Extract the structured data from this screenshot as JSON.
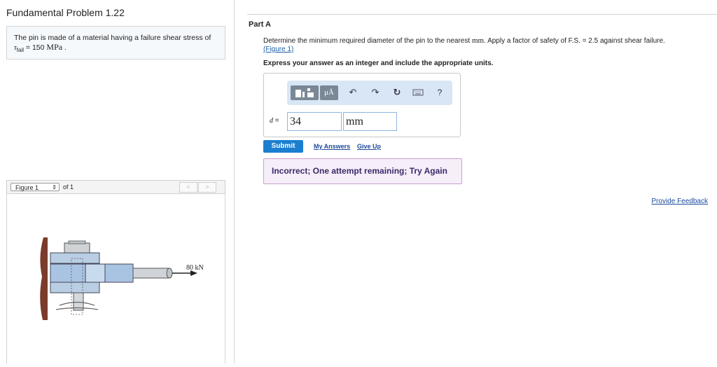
{
  "problem": {
    "title": "Fundamental Problem 1.22",
    "intro_text": "The pin is made of a material having a failure shear stress of",
    "tau_symbol": "τ",
    "tau_subscript": "fail",
    "tau_value": " = 150 ",
    "tau_unit": "MPa",
    "tau_period": " ."
  },
  "figure_nav": {
    "selected": "Figure 1",
    "of_label": "of 1",
    "prev": "<",
    "next": ">"
  },
  "figure": {
    "load_label": "80 kN"
  },
  "part": {
    "label": "Part A",
    "question_pre": "Determine the minimum required diameter of the pin to the nearest ",
    "question_unit": "mm",
    "question_post": ". Apply a factor of safety of F.S. = 2.5 against shear failure.",
    "figure_link": "(Figure 1)",
    "instruction": "Express your answer as an integer and include the appropriate units."
  },
  "toolbar": {
    "units_button": "μÅ",
    "undo": "↶",
    "redo": "↷",
    "reset": "↻",
    "help": "?"
  },
  "answer": {
    "variable": "d",
    "equals": " =",
    "value": "34",
    "unit": "mm"
  },
  "actions": {
    "submit": "Submit",
    "my_answers": "My Answers",
    "give_up": "Give Up"
  },
  "feedback": {
    "message": "Incorrect; One attempt remaining; Try Again"
  },
  "footer": {
    "provide_feedback": "Provide Feedback"
  }
}
